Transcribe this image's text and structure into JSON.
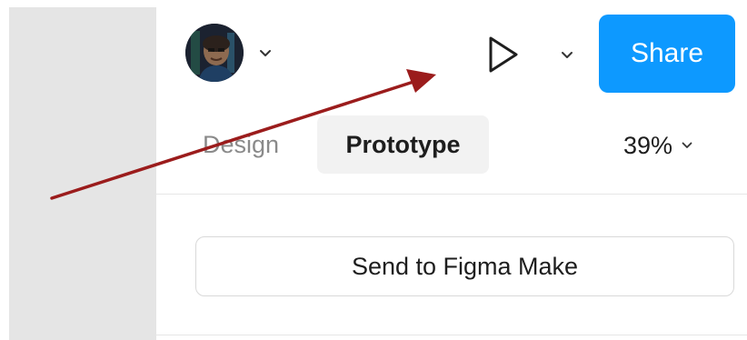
{
  "header": {
    "avatar_alt": "User avatar",
    "play_icon": "play-icon",
    "share_label": "Share",
    "accent_color": "#0d99ff"
  },
  "tabs": [
    {
      "label": "Design",
      "active": false
    },
    {
      "label": "Prototype",
      "active": true
    }
  ],
  "zoom": {
    "value": "39%"
  },
  "actions": {
    "send_to_make_label": "Send to Figma Make"
  },
  "annotation": {
    "arrow_color": "#9b1c1c"
  }
}
